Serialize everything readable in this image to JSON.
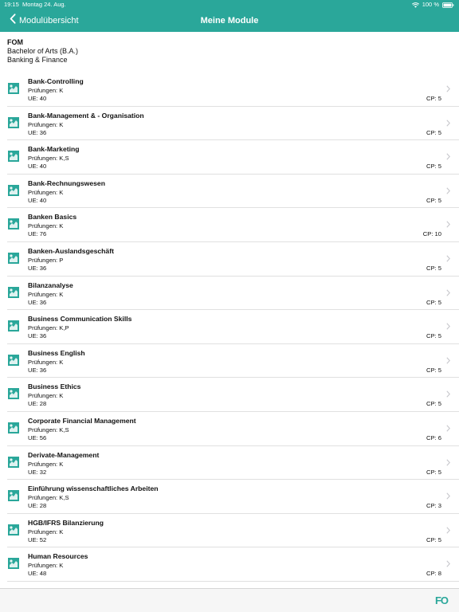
{
  "status_bar": {
    "time": "19:15",
    "date": "Montag 24. Aug.",
    "battery": "100 %"
  },
  "nav": {
    "back_label": "Modulübersicht",
    "title": "Meine Module"
  },
  "program": {
    "org": "FOM",
    "degree": "Bachelor of Arts (B.A.)",
    "field": "Banking & Finance"
  },
  "modules": [
    {
      "title": "Bank-Controlling",
      "exams": "Prüfungen: K",
      "ue": "UE: 40",
      "cp": "CP: 5"
    },
    {
      "title": "Bank-Management & - Organisation",
      "exams": "Prüfungen: K",
      "ue": "UE: 36",
      "cp": "CP: 5"
    },
    {
      "title": "Bank-Marketing",
      "exams": "Prüfungen: K,S",
      "ue": "UE: 40",
      "cp": "CP: 5"
    },
    {
      "title": "Bank-Rechnungswesen",
      "exams": "Prüfungen: K",
      "ue": "UE: 40",
      "cp": "CP: 5"
    },
    {
      "title": "Banken Basics",
      "exams": "Prüfungen: K",
      "ue": "UE: 76",
      "cp": "CP: 10"
    },
    {
      "title": "Banken-Auslandsgeschäft",
      "exams": "Prüfungen: P",
      "ue": "UE: 36",
      "cp": "CP: 5"
    },
    {
      "title": "Bilanzanalyse",
      "exams": "Prüfungen: K",
      "ue": "UE: 36",
      "cp": "CP: 5"
    },
    {
      "title": "Business Communication Skills",
      "exams": "Prüfungen: K,P",
      "ue": "UE: 36",
      "cp": "CP: 5"
    },
    {
      "title": "Business English",
      "exams": "Prüfungen: K",
      "ue": "UE: 36",
      "cp": "CP: 5"
    },
    {
      "title": "Business Ethics",
      "exams": "Prüfungen: K",
      "ue": "UE: 28",
      "cp": "CP: 5"
    },
    {
      "title": "Corporate Financial Management",
      "exams": "Prüfungen: K,S",
      "ue": "UE: 56",
      "cp": "CP: 6"
    },
    {
      "title": "Derivate-Management",
      "exams": "Prüfungen: K",
      "ue": "UE: 32",
      "cp": "CP: 5"
    },
    {
      "title": "Einführung wissenschaftliches Arbeiten",
      "exams": "Prüfungen: K,S",
      "ue": "UE: 28",
      "cp": "CP: 3"
    },
    {
      "title": "HGB/IFRS Bilanzierung",
      "exams": "Prüfungen: K",
      "ue": "UE: 52",
      "cp": "CP: 5"
    },
    {
      "title": "Human Resources",
      "exams": "Prüfungen: K",
      "ue": "UE: 48",
      "cp": "CP: 8"
    }
  ],
  "tab_bar": {
    "logo": "FO"
  },
  "colors": {
    "accent": "#2aa79a"
  },
  "icons": {
    "module": "puzzle-icon",
    "row_chevron": "chevron-right-icon",
    "back": "chevron-left-icon"
  }
}
